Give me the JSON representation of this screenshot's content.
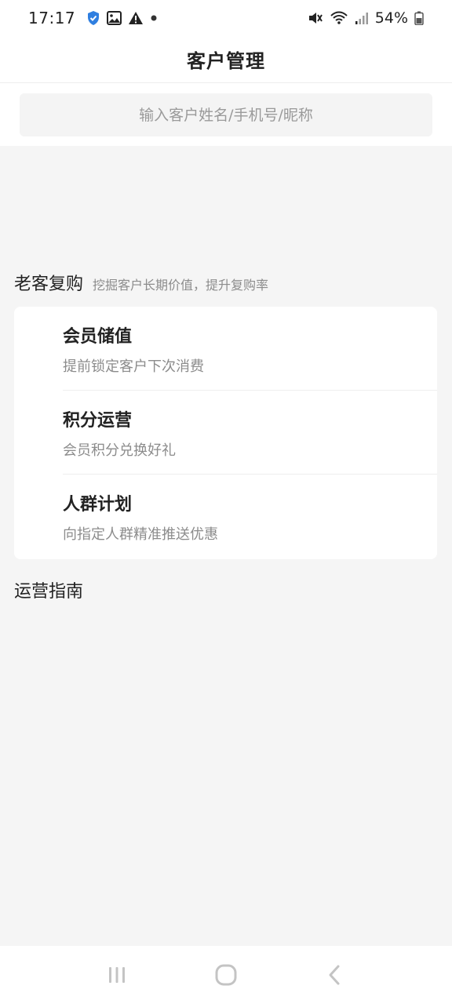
{
  "status_bar": {
    "time": "17:17",
    "battery": "54%",
    "left_icons": [
      "shield-check-icon",
      "image-icon",
      "warning-icon",
      "dot-icon"
    ],
    "right_icons": [
      "mute-icon",
      "wifi-icon",
      "signal-icon",
      "battery-icon"
    ]
  },
  "header": {
    "title": "客户管理"
  },
  "search": {
    "placeholder": "输入客户姓名/手机号/昵称",
    "value": ""
  },
  "repurchase_section": {
    "title": "老客复购",
    "subtitle": "挖掘客户长期价值，提升复购率",
    "items": [
      {
        "title": "会员储值",
        "desc": "提前锁定客户下次消费"
      },
      {
        "title": "积分运营",
        "desc": "会员积分兑换好礼"
      },
      {
        "title": "人群计划",
        "desc": "向指定人群精准推送优惠"
      }
    ]
  },
  "guide_section": {
    "title": "运营指南"
  },
  "nav_bar": {
    "buttons": [
      "recent-apps-icon",
      "home-icon",
      "back-icon"
    ]
  }
}
